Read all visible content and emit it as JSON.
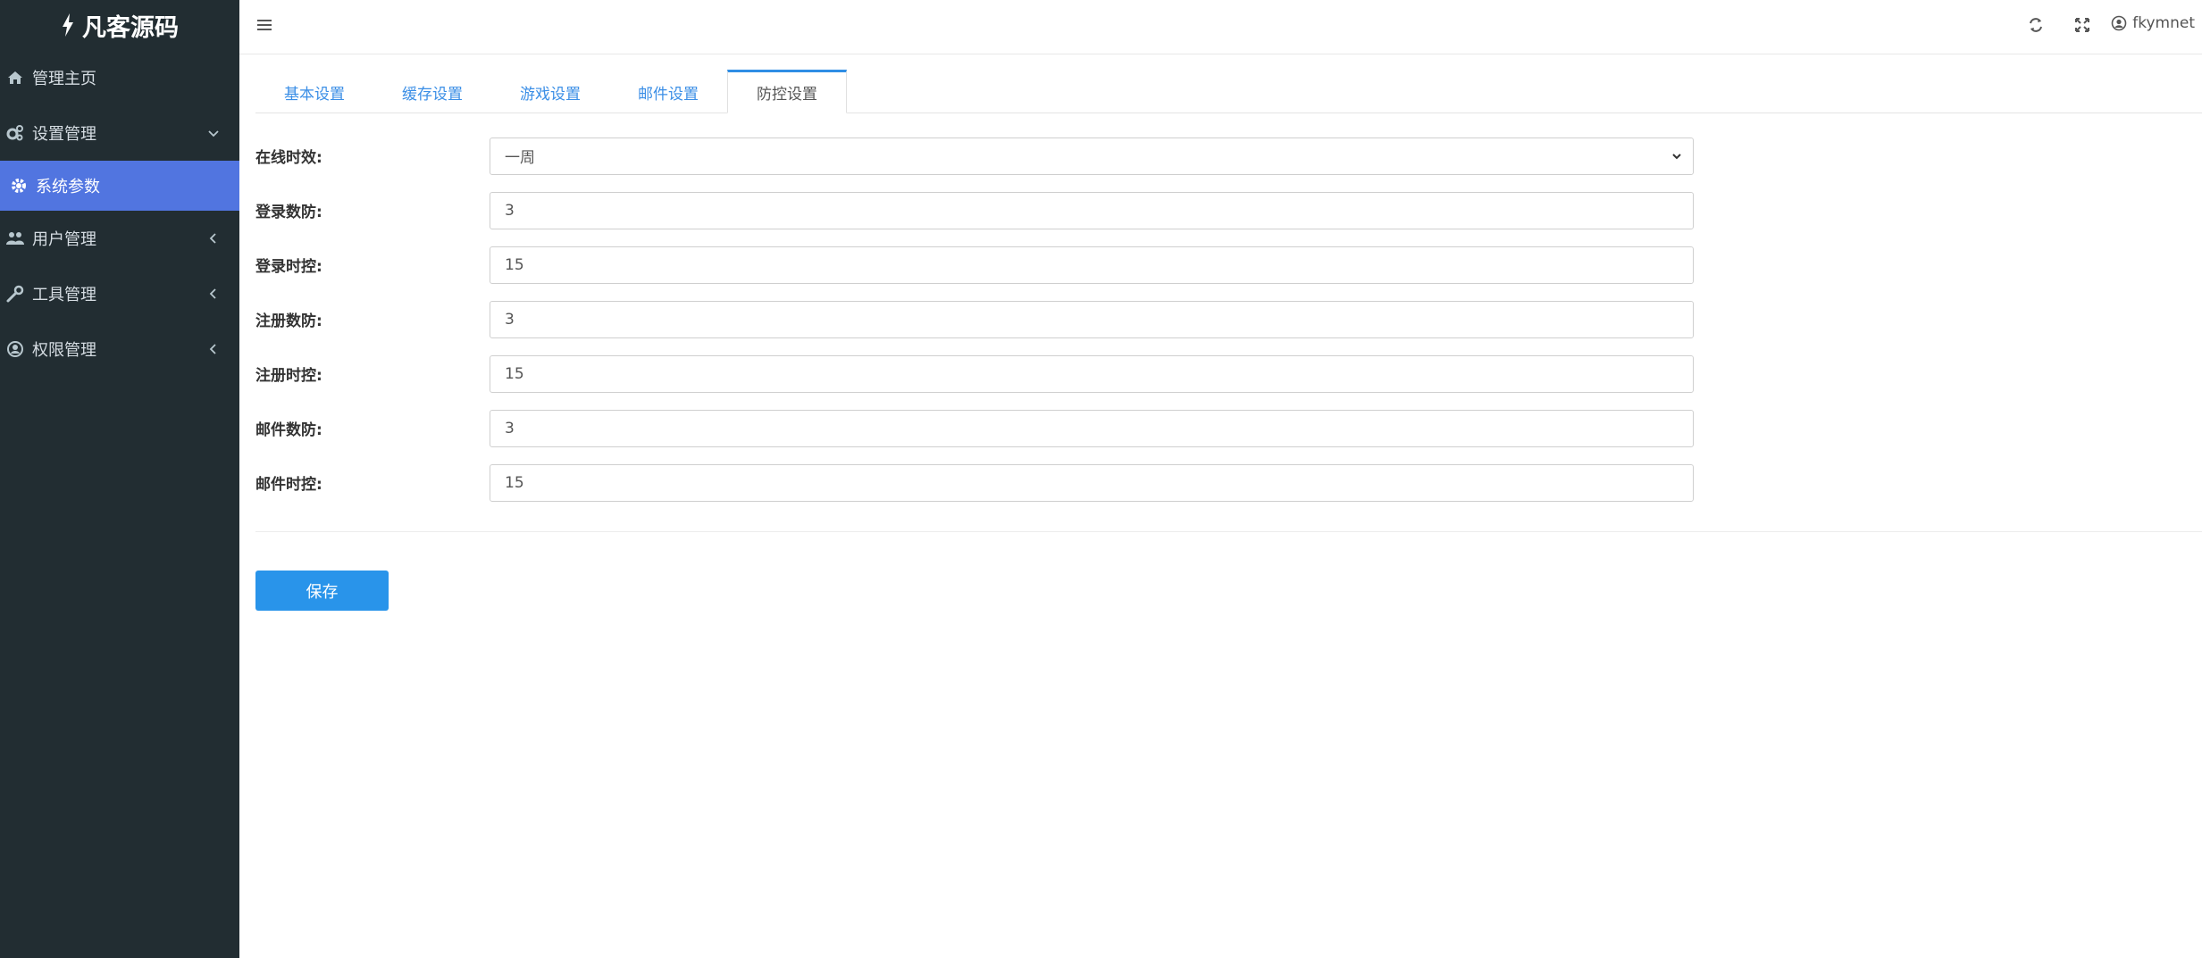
{
  "brand": {
    "title": "凡客源码"
  },
  "sidebar": {
    "items": [
      {
        "label": "管理主页"
      },
      {
        "label": "设置管理"
      },
      {
        "label": "系统参数"
      },
      {
        "label": "用户管理"
      },
      {
        "label": "工具管理"
      },
      {
        "label": "权限管理"
      }
    ]
  },
  "topbar": {
    "username": "fkymnet"
  },
  "tabs": [
    {
      "label": "基本设置"
    },
    {
      "label": "缓存设置"
    },
    {
      "label": "游戏设置"
    },
    {
      "label": "邮件设置"
    },
    {
      "label": "防控设置"
    }
  ],
  "form": {
    "online": {
      "label": "在线时效:",
      "value": "一周"
    },
    "login_count": {
      "label": "登录数防:",
      "value": "3"
    },
    "login_time": {
      "label": "登录时控:",
      "value": "15"
    },
    "register_count": {
      "label": "注册数防:",
      "value": "3"
    },
    "register_time": {
      "label": "注册时控:",
      "value": "15"
    },
    "mail_count": {
      "label": "邮件数防:",
      "value": "3"
    },
    "mail_time": {
      "label": "邮件时控:",
      "value": "15"
    }
  },
  "actions": {
    "save_label": "保存"
  },
  "colors": {
    "sidebar_bg": "#222d32",
    "sidebar_active": "#5175e0",
    "primary": "#2994ea",
    "tab_link": "#3a8ee6"
  }
}
